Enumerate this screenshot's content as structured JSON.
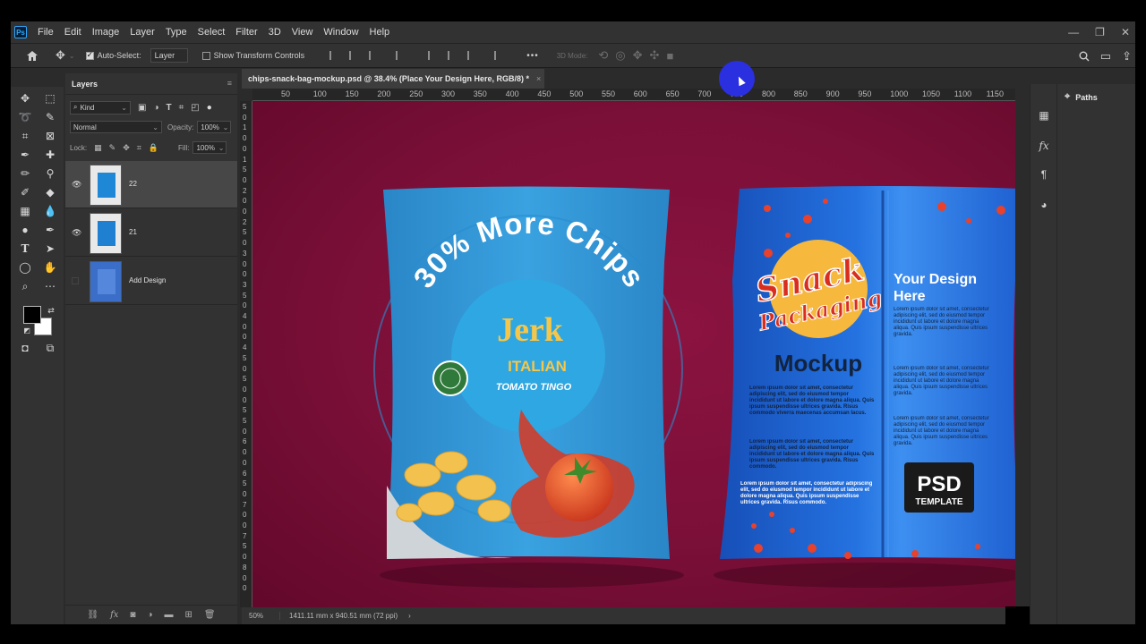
{
  "menu": {
    "logo": "Ps",
    "items": [
      "File",
      "Edit",
      "Image",
      "Layer",
      "Type",
      "Select",
      "Filter",
      "3D",
      "View",
      "Window",
      "Help"
    ]
  },
  "window_controls": {
    "minimize": "—",
    "restore": "❐",
    "close": "✕"
  },
  "options_bar": {
    "auto_select_label": "Auto-Select:",
    "auto_select_target": "Layer",
    "show_transform_label": "Show Transform Controls",
    "more": "•••",
    "mode_label": "3D Mode:"
  },
  "layers_panel": {
    "title": "Layers",
    "filter_kind": "Kind",
    "blend_mode": "Normal",
    "opacity_label": "Opacity:",
    "opacity_value": "100%",
    "lock_label": "Lock:",
    "fill_label": "Fill:",
    "fill_value": "100%",
    "layers": [
      {
        "name": "22",
        "visible": true,
        "selected": true
      },
      {
        "name": "21",
        "visible": true,
        "selected": false
      },
      {
        "name": "Add Design",
        "visible": false,
        "selected": false
      }
    ],
    "bottom_icons": [
      "link-icon",
      "fx-icon",
      "mask-icon",
      "adjustment-icon",
      "folder-icon",
      "new-layer-icon",
      "trash-icon"
    ]
  },
  "document": {
    "tab_title": "chips-snack-bag-mockup.psd @ 38.4% (Place Your Design Here, RGB/8) *",
    "tab_close": "×",
    "ruler_top": [
      "50",
      "100",
      "150",
      "200",
      "250",
      "300",
      "350",
      "400",
      "450",
      "500",
      "550",
      "600",
      "650",
      "700",
      "750",
      "800",
      "850",
      "900",
      "950",
      "1000",
      "1050",
      "1100",
      "1150",
      "12"
    ],
    "ruler_left": [
      "5",
      "0",
      "1",
      "0",
      "0",
      "1",
      "5",
      "0",
      "2",
      "0",
      "0",
      "2",
      "5",
      "0",
      "3",
      "0",
      "0",
      "3",
      "5",
      "0",
      "4",
      "0",
      "0",
      "4",
      "5",
      "0",
      "5",
      "0",
      "0",
      "5",
      "5",
      "0",
      "6",
      "0",
      "0",
      "6",
      "5",
      "0",
      "7",
      "0",
      "0",
      "7",
      "5",
      "0",
      "8",
      "0",
      "0"
    ],
    "zoom": "50%",
    "dimensions": "1411.11 mm x 940.51 mm (72 ppi)",
    "status_arrow": "›"
  },
  "bag_front": {
    "headline": "30% More Chips",
    "brand": "Jerk",
    "flavor": "ITALIAN",
    "subflavor": "TOMATO TINGO"
  },
  "bag_back": {
    "title_line1": "Snack",
    "title_line2": "Packaging",
    "mockup": "Mockup",
    "your_design_line1": "Your Design",
    "your_design_line2": "Here",
    "lorem_block_a": "Lorem ipsum dolor sit amet, consectetur adipiscing elit, sed do eiusmod tempor incididunt ut labore et dolore magna aliqua. Quis ipsum suspendisse ultrices gravida. Risus commodo viverra maecenas accumsan lacus.",
    "lorem_block_b": "Lorem ipsum dolor sit amet, consectetur adipiscing elit, sed do eiusmod tempor incididunt ut labore et dolore magna aliqua. Quis ipsum suspendisse ultrices gravida. Risus commodo.",
    "lorem_right": "Lorem ipsum dolor sit amet, consectetur adipiscing elit, sed do eiusmod tempor incididunt ut labore et dolore magna aliqua. Quis ipsum suspendisse ultrices gravida.",
    "psd": "PSD",
    "template": "TEMPLATE"
  },
  "right_panel": {
    "paths_label": "Paths"
  },
  "colors": {
    "canvas_bg": "#7a0f37",
    "bag_blue": "#2f8fd0",
    "bag_back_blue": "#1e64d6",
    "accent_yellow": "#f6b83d",
    "accent_red": "#e8412c"
  }
}
